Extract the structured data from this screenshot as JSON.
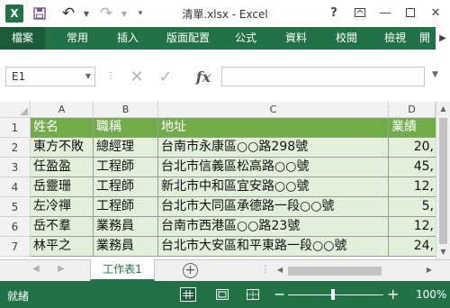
{
  "window": {
    "title": "清單.xlsx - Excel",
    "excel_logo_letter": "X",
    "help": "?"
  },
  "ribbon": {
    "tabs": [
      "檔案",
      "常用",
      "插入",
      "版面配置",
      "公式",
      "資料",
      "校閱",
      "檢視",
      "開"
    ],
    "accent_color": "#217346"
  },
  "formula_bar": {
    "name_box": "E1",
    "fx_label": "fx",
    "formula_value": ""
  },
  "grid": {
    "columns": [
      "A",
      "B",
      "C",
      "D"
    ],
    "row_numbers": [
      "1",
      "2",
      "3",
      "4",
      "5",
      "6",
      "7"
    ],
    "header_row": [
      "姓名",
      "職稱",
      "地址",
      "業績"
    ],
    "rows": [
      [
        "東方不敗",
        "總經理",
        "台南市永康區○○路298號",
        "20,"
      ],
      [
        "任盈盈",
        "工程師",
        "台北市信義區松高路○○號",
        "45,"
      ],
      [
        "岳靈珊",
        "工程師",
        "新北市中和區宜安路○○號",
        "12,"
      ],
      [
        "左冷禪",
        "工程師",
        "台北市大同區承德路一段○○號",
        "5,"
      ],
      [
        "岳不羣",
        "業務員",
        "台南市西港區○○路23號",
        "12,"
      ],
      [
        "林平之",
        "業務員",
        "台北市大安區和平東路一段○○號",
        "24,"
      ]
    ],
    "header_color": "#70ad47",
    "body_color": "#e2efd9"
  },
  "sheets": {
    "active": "工作表1"
  },
  "status": {
    "text": "就緒",
    "zoom_level": "100%"
  }
}
